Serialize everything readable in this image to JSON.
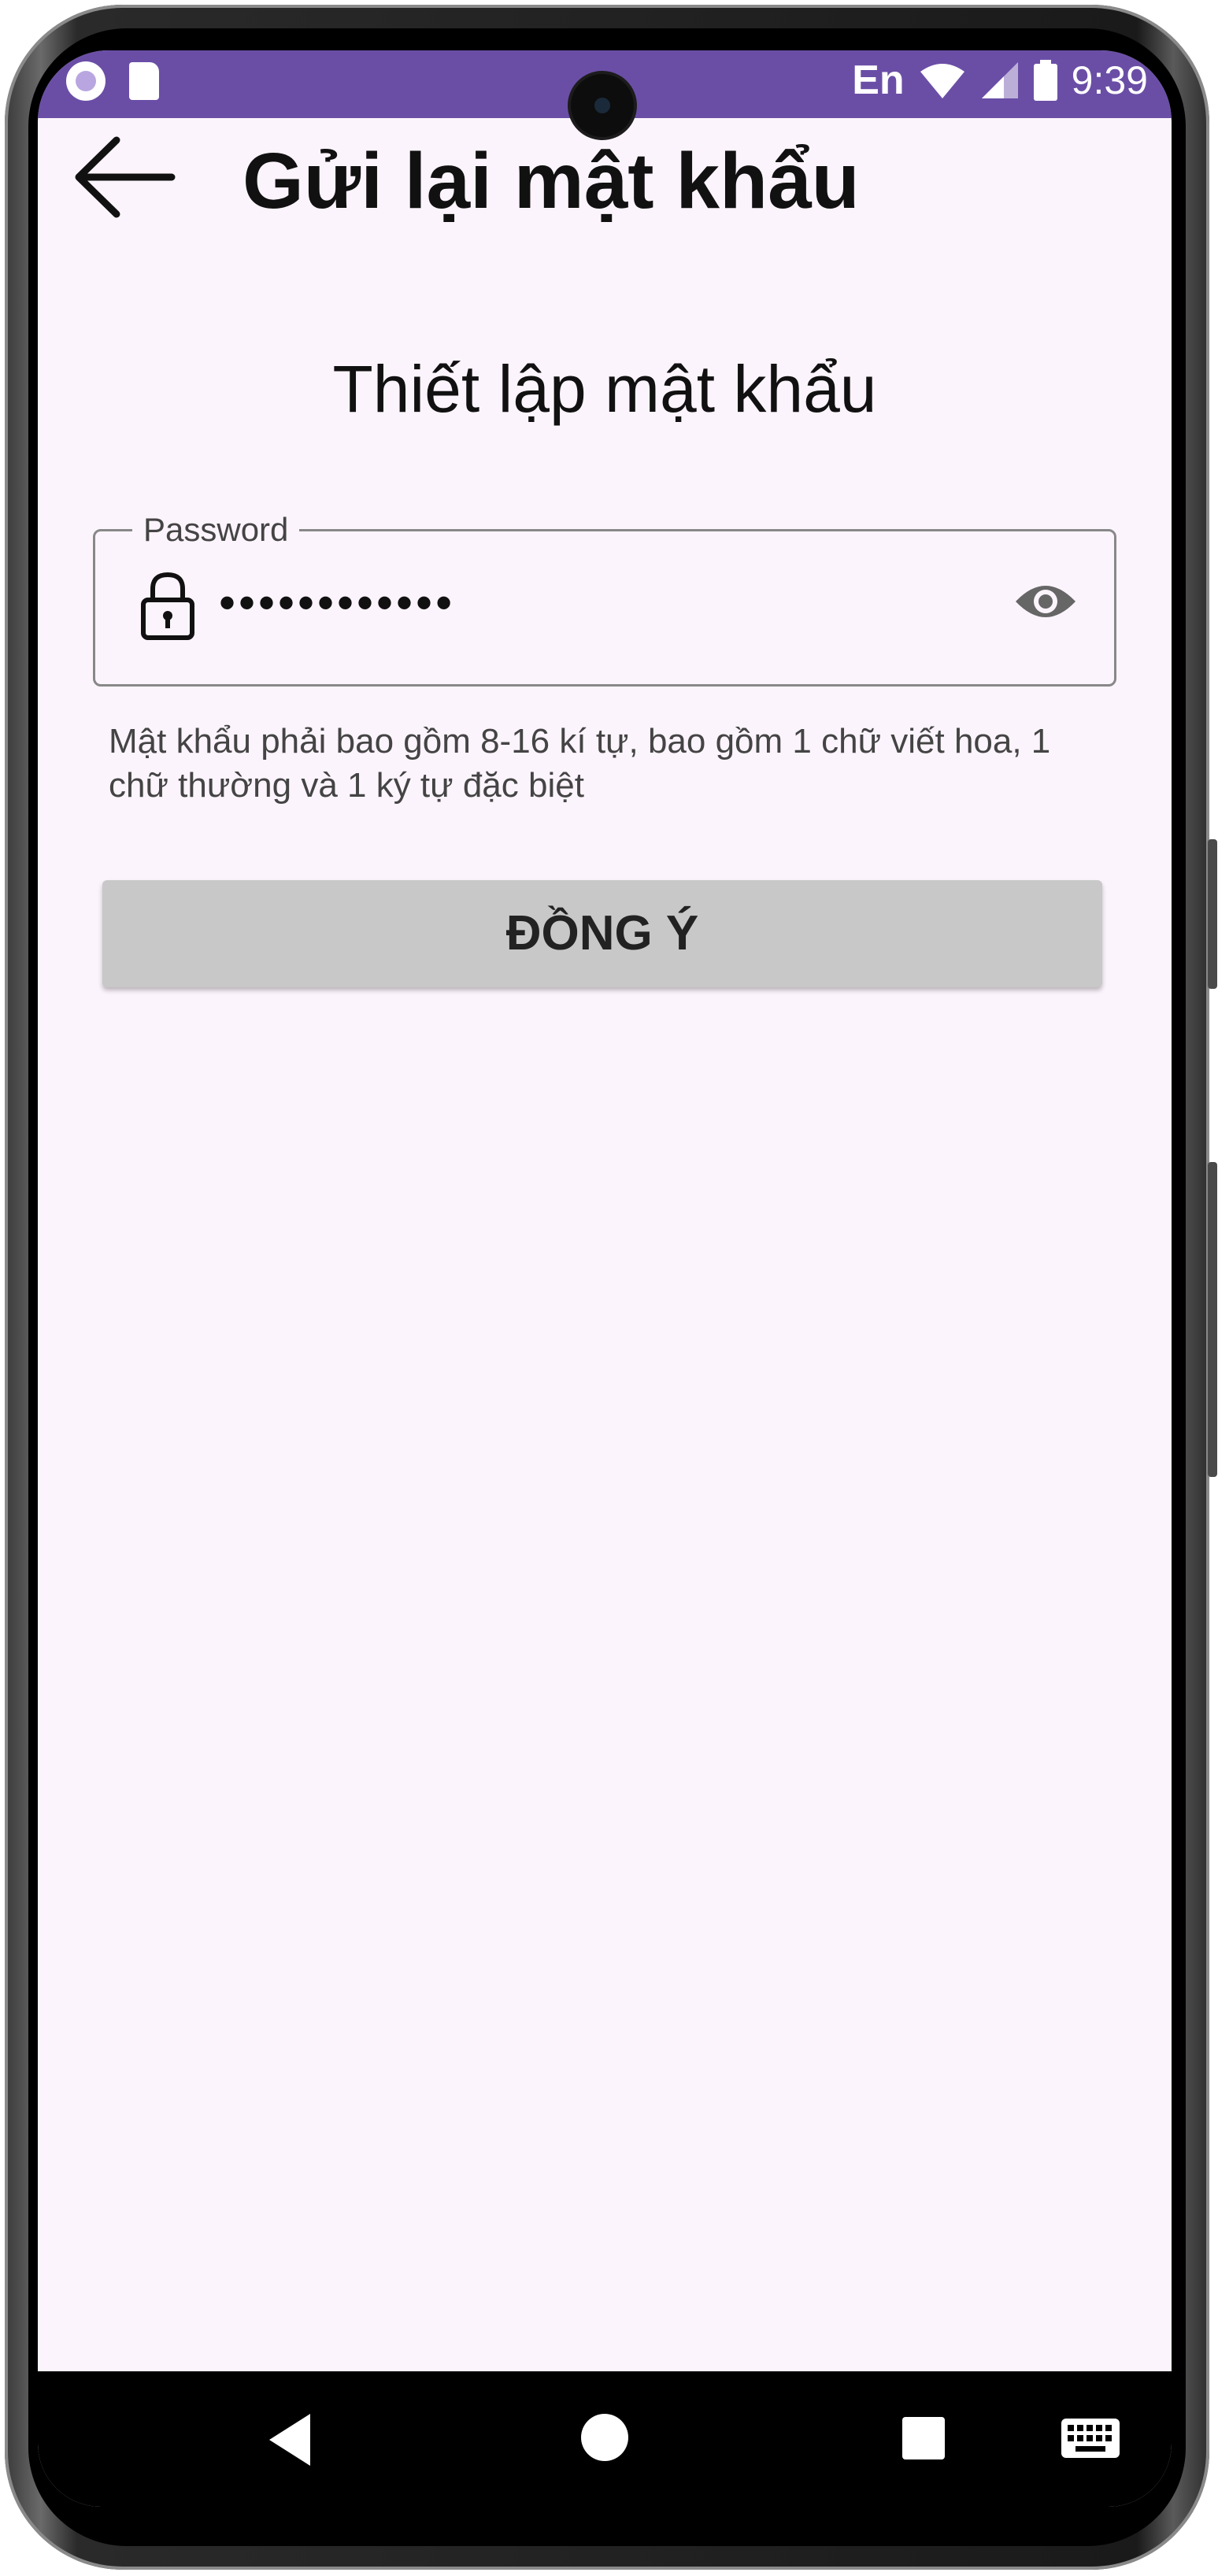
{
  "status_bar": {
    "keyboard_lang": "En",
    "time": "9:39",
    "icons": [
      "notification-circle-icon",
      "sd-card-icon",
      "wifi-icon",
      "signal-icon",
      "battery-icon"
    ],
    "background_color": "#6a4ea6"
  },
  "app_bar": {
    "title": "Gửi lại mật khẩu",
    "back_icon": "arrow-left-icon"
  },
  "form": {
    "section_title": "Thiết lập mật khẩu",
    "password_field": {
      "label": "Password",
      "value": "••••••••••••",
      "leading_icon": "lock-icon",
      "trailing_icon": "eye-icon"
    },
    "hint": "Mật khẩu phải bao gồm 8-16 kí tự, bao gồm 1 chữ viết hoa, 1 chữ thường và 1 ký tự đặc biệt",
    "submit_label": "ĐỒNG Ý",
    "submit_color": "#c8c8c8"
  },
  "nav_bar": {
    "icons": [
      "back-triangle-icon",
      "home-circle-icon",
      "recents-square-icon",
      "keyboard-icon"
    ]
  },
  "colors": {
    "screen_background": "#fcf4fc",
    "accent": "#6a4ea6"
  }
}
